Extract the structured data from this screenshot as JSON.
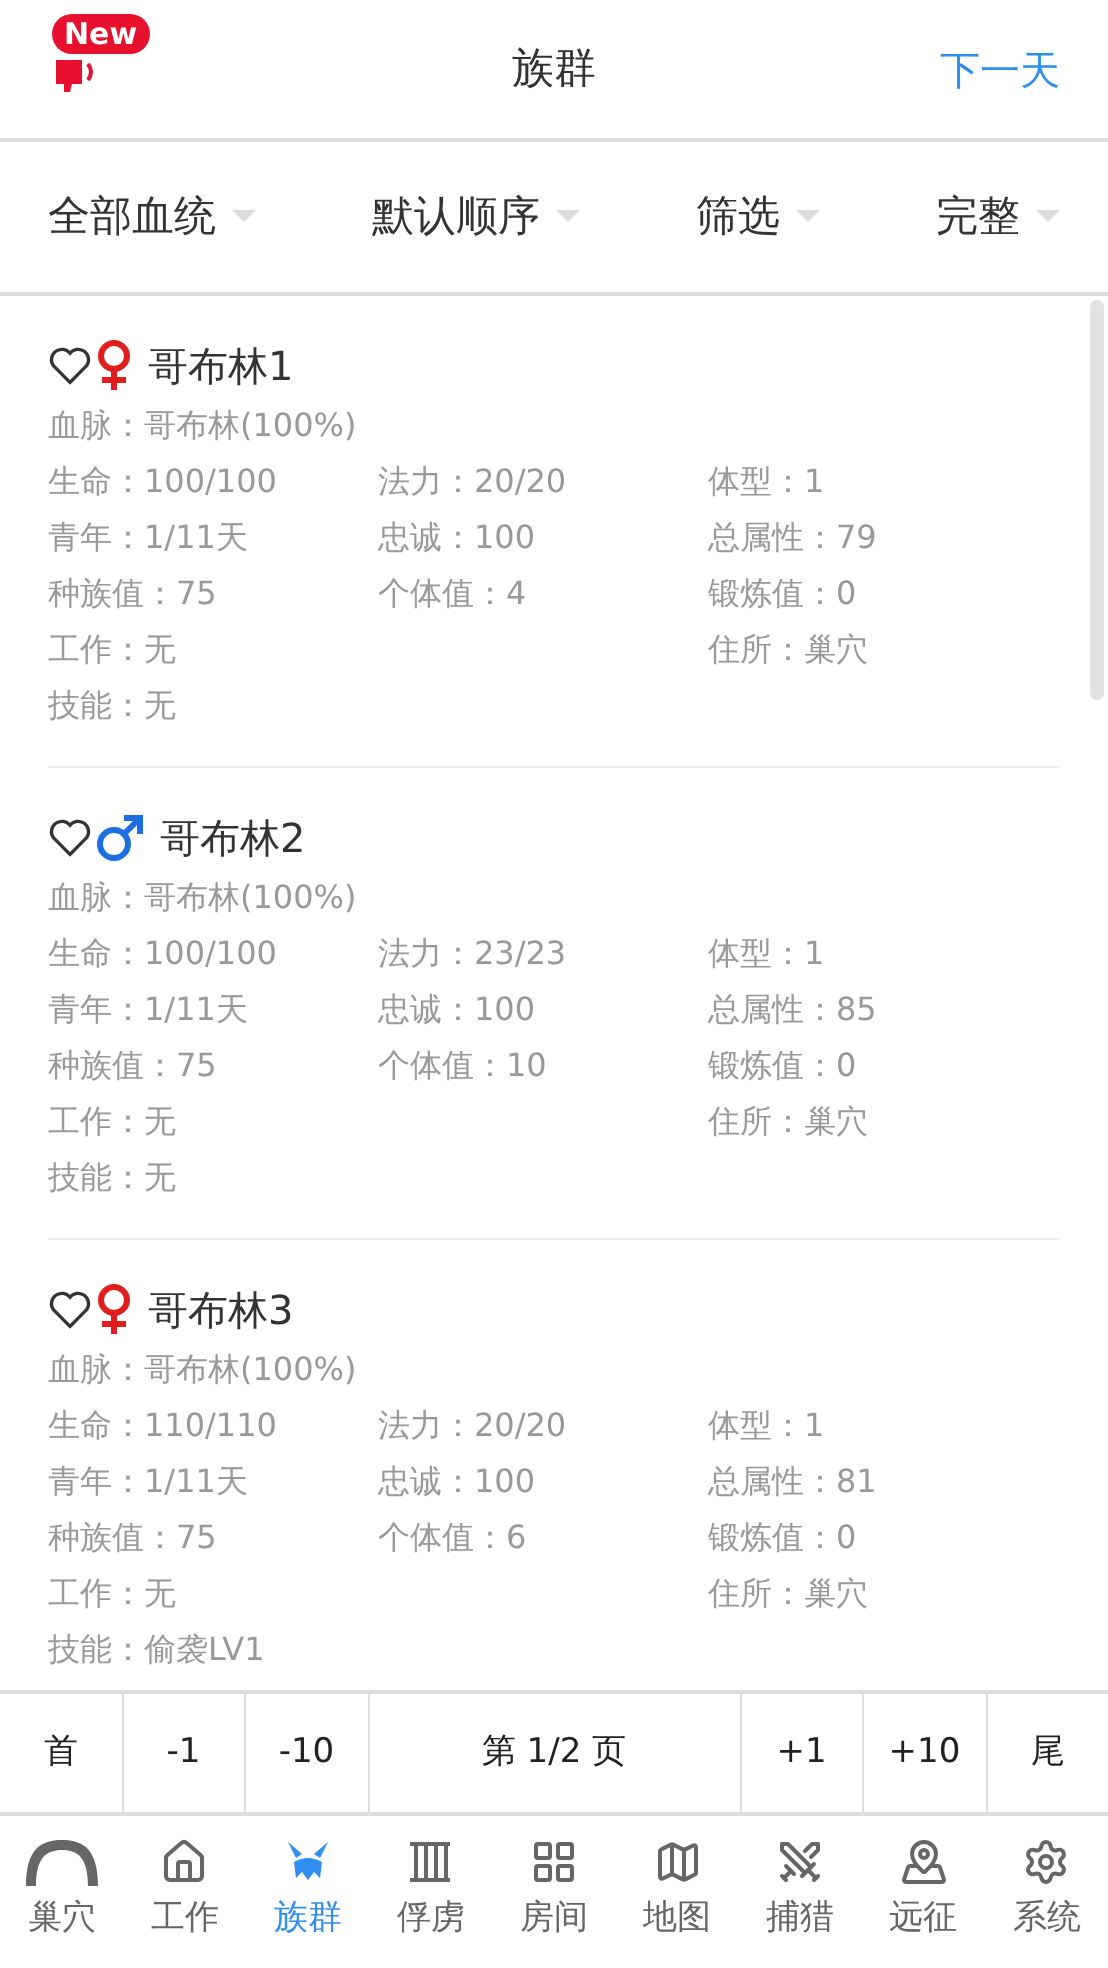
{
  "header": {
    "badge": "New",
    "title": "族群",
    "action": "下一天"
  },
  "filters": [
    {
      "label": "全部血统"
    },
    {
      "label": "默认顺序"
    },
    {
      "label": "筛选"
    },
    {
      "label": "完整"
    }
  ],
  "members": [
    {
      "favorite": false,
      "kind": "female",
      "name": "哥布林1",
      "bloodline": "血脉：哥布林(100%)",
      "rows": [
        {
          "left": "生命：100/100",
          "middle": "法力：20/20",
          "right": "体型：1"
        },
        {
          "left": "青年：1/11天",
          "middle": "忠诚：100",
          "right": "总属性：79"
        },
        {
          "left": "种族值：75",
          "middle": "个体值：4",
          "right": "锻炼值：0"
        },
        {
          "left": "工作：无",
          "right": "住所：巢穴"
        },
        {
          "left": "技能：无"
        }
      ]
    },
    {
      "favorite": false,
      "kind": "male",
      "name": "哥布林2",
      "bloodline": "血脉：哥布林(100%)",
      "rows": [
        {
          "left": "生命：100/100",
          "middle": "法力：23/23",
          "right": "体型：1"
        },
        {
          "left": "青年：1/11天",
          "middle": "忠诚：100",
          "right": "总属性：85"
        },
        {
          "left": "种族值：75",
          "middle": "个体值：10",
          "right": "锻炼值：0"
        },
        {
          "left": "工作：无",
          "right": "住所：巢穴"
        },
        {
          "left": "技能：无"
        }
      ]
    },
    {
      "favorite": false,
      "kind": "female",
      "name": "哥布林3",
      "bloodline": "血脉：哥布林(100%)",
      "rows": [
        {
          "left": "生命：110/110",
          "middle": "法力：20/20",
          "right": "体型：1"
        },
        {
          "left": "青年：1/11天",
          "middle": "忠诚：100",
          "right": "总属性：81"
        },
        {
          "left": "种族值：75",
          "middle": "个体值：6",
          "right": "锻炼值：0"
        },
        {
          "left": "工作：无",
          "right": "住所：巢穴"
        },
        {
          "left": "技能：偷袭LV1"
        }
      ]
    }
  ],
  "pagination": [
    {
      "label": "首"
    },
    {
      "label": "-1"
    },
    {
      "label": "-10"
    },
    {
      "label": "第 1/2 页",
      "kind": "status"
    },
    {
      "label": "+1"
    },
    {
      "label": "+10"
    },
    {
      "label": "尾"
    }
  ],
  "nav": [
    {
      "label": "巢穴",
      "selected": false
    },
    {
      "label": "工作",
      "selected": false
    },
    {
      "label": "族群",
      "selected": true
    },
    {
      "label": "俘虏",
      "selected": false
    },
    {
      "label": "房间",
      "selected": false
    },
    {
      "label": "地图",
      "selected": false
    },
    {
      "label": "捕猎",
      "selected": false
    },
    {
      "label": "远征",
      "selected": false
    },
    {
      "label": "系统",
      "selected": false
    }
  ]
}
